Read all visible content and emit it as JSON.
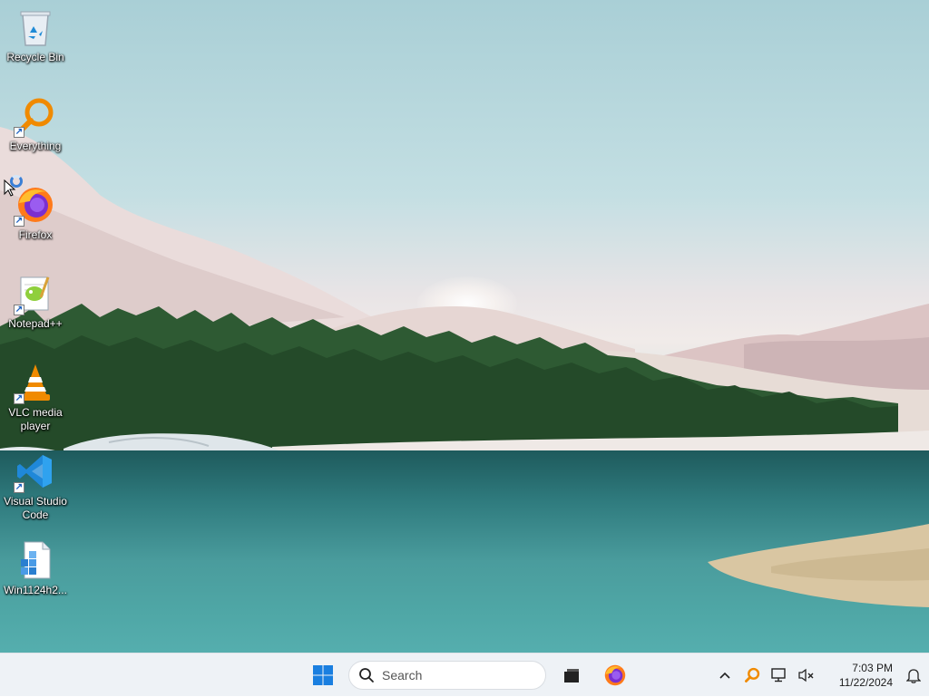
{
  "desktop": {
    "icons": [
      {
        "label": "Recycle Bin",
        "icon": "recycle-bin-icon"
      },
      {
        "label": "Everything",
        "icon": "everything-search-icon"
      },
      {
        "label": "Firefox",
        "icon": "firefox-icon"
      },
      {
        "label": "Notepad++",
        "icon": "notepadpp-icon"
      },
      {
        "label": "VLC media player",
        "icon": "vlc-icon"
      },
      {
        "label": "Visual Studio Code",
        "icon": "vscode-icon"
      },
      {
        "label": "Win1124h2...",
        "icon": "registry-file-icon"
      }
    ]
  },
  "taskbar": {
    "search_placeholder": "Search",
    "pinned": [
      "start-icon",
      "task-view-icon",
      "firefox-icon"
    ],
    "tray": {
      "icons": [
        "show-hidden-icons-chevron",
        "everything-search-icon",
        "network-icon",
        "volume-muted-icon"
      ],
      "time": "7:03 PM",
      "date": "11/22/2024"
    }
  },
  "colors": {
    "taskbar_bg": "#eef2f6",
    "start_blue": "#1a7fe0",
    "firefox_orange": "#ff6611"
  }
}
